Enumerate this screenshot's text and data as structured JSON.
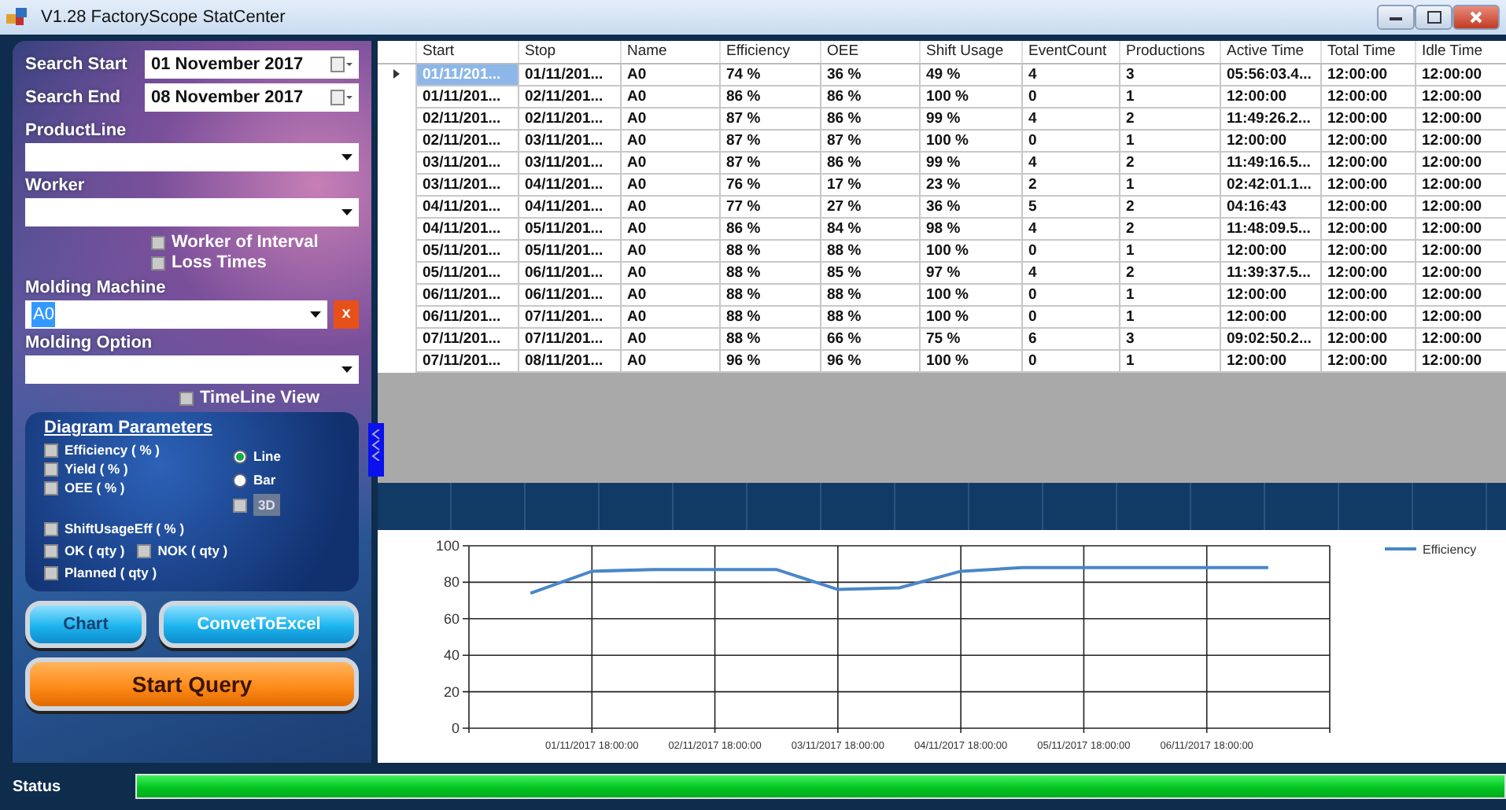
{
  "window": {
    "title": "V1.28 FactoryScope StatCenter"
  },
  "filters": {
    "search_start": {
      "label": "Search Start",
      "value": "01 November 2017"
    },
    "search_end": {
      "label": "Search End",
      "value": "08 November 2017"
    },
    "product_line": {
      "label": "ProductLine"
    },
    "worker": {
      "label": "Worker"
    },
    "worker_options": [
      {
        "label": "Worker of Interval",
        "checked": false
      },
      {
        "label": "Loss Times",
        "checked": false
      }
    ],
    "molding_machine": {
      "label": "Molding Machine",
      "value": "A0",
      "clear": "x"
    },
    "molding_option": {
      "label": "Molding Option"
    },
    "timeline_view": {
      "label": "TimeLine View",
      "checked": false
    }
  },
  "diagram_parameters": {
    "title": "Diagram Parameters",
    "column_a": [
      {
        "kind": "checkbox",
        "label": "Efficiency ( % )",
        "checked": false
      },
      {
        "kind": "checkbox",
        "label": "Yield ( % )",
        "checked": false
      },
      {
        "kind": "checkbox",
        "label": "OEE ( % )",
        "checked": false
      }
    ],
    "column_b": [
      {
        "kind": "radio",
        "label": "Line",
        "selected": true,
        "disabled": false
      },
      {
        "kind": "radio",
        "label": "Bar",
        "selected": false,
        "disabled": false
      },
      {
        "kind": "checkbox",
        "label": "3D",
        "checked": false,
        "disabled": true
      }
    ],
    "rows": [
      [
        {
          "label": "ShiftUsageEff ( % )",
          "checked": false
        }
      ],
      [
        {
          "label": "OK ( qty )",
          "checked": false
        },
        {
          "label": "NOK ( qty )",
          "checked": false
        }
      ],
      [
        {
          "label": "Planned ( qty )",
          "checked": false
        }
      ]
    ]
  },
  "buttons": {
    "chart": "Chart",
    "excel": "ConvetToExcel",
    "query": "Start Query"
  },
  "table": {
    "columns": [
      "Start",
      "Stop",
      "Name",
      "Efficiency",
      "OEE",
      "Shift Usage",
      "EventCount",
      "Productions",
      "Active Time",
      "Total Time",
      "Idle Time"
    ],
    "rows": [
      {
        "selected": true,
        "cells": [
          "01/11/201...",
          "01/11/201...",
          "A0",
          "74 %",
          "36 %",
          "49 %",
          "4",
          "3",
          "05:56:03.4...",
          "12:00:00",
          "12:00:00"
        ]
      },
      {
        "selected": false,
        "cells": [
          "01/11/201...",
          "02/11/201...",
          "A0",
          "86 %",
          "86 %",
          "100 %",
          "0",
          "1",
          "12:00:00",
          "12:00:00",
          "12:00:00"
        ]
      },
      {
        "selected": false,
        "cells": [
          "02/11/201...",
          "02/11/201...",
          "A0",
          "87 %",
          "86 %",
          "99 %",
          "4",
          "2",
          "11:49:26.2...",
          "12:00:00",
          "12:00:00"
        ]
      },
      {
        "selected": false,
        "cells": [
          "02/11/201...",
          "03/11/201...",
          "A0",
          "87 %",
          "87 %",
          "100 %",
          "0",
          "1",
          "12:00:00",
          "12:00:00",
          "12:00:00"
        ]
      },
      {
        "selected": false,
        "cells": [
          "03/11/201...",
          "03/11/201...",
          "A0",
          "87 %",
          "86 %",
          "99 %",
          "4",
          "2",
          "11:49:16.5...",
          "12:00:00",
          "12:00:00"
        ]
      },
      {
        "selected": false,
        "cells": [
          "03/11/201...",
          "04/11/201...",
          "A0",
          "76 %",
          "17 %",
          "23 %",
          "2",
          "1",
          "02:42:01.1...",
          "12:00:00",
          "12:00:00"
        ]
      },
      {
        "selected": false,
        "cells": [
          "04/11/201...",
          "04/11/201...",
          "A0",
          "77 %",
          "27 %",
          "36 %",
          "5",
          "2",
          "04:16:43",
          "12:00:00",
          "12:00:00"
        ]
      },
      {
        "selected": false,
        "cells": [
          "04/11/201...",
          "05/11/201...",
          "A0",
          "86 %",
          "84 %",
          "98 %",
          "4",
          "2",
          "11:48:09.5...",
          "12:00:00",
          "12:00:00"
        ]
      },
      {
        "selected": false,
        "cells": [
          "05/11/201...",
          "05/11/201...",
          "A0",
          "88 %",
          "88 %",
          "100 %",
          "0",
          "1",
          "12:00:00",
          "12:00:00",
          "12:00:00"
        ]
      },
      {
        "selected": false,
        "cells": [
          "05/11/201...",
          "06/11/201...",
          "A0",
          "88 %",
          "85 %",
          "97 %",
          "4",
          "2",
          "11:39:37.5...",
          "12:00:00",
          "12:00:00"
        ]
      },
      {
        "selected": false,
        "cells": [
          "06/11/201...",
          "06/11/201...",
          "A0",
          "88 %",
          "88 %",
          "100 %",
          "0",
          "1",
          "12:00:00",
          "12:00:00",
          "12:00:00"
        ]
      },
      {
        "selected": false,
        "cells": [
          "06/11/201...",
          "07/11/201...",
          "A0",
          "88 %",
          "88 %",
          "100 %",
          "0",
          "1",
          "12:00:00",
          "12:00:00",
          "12:00:00"
        ]
      },
      {
        "selected": false,
        "cells": [
          "07/11/201...",
          "07/11/201...",
          "A0",
          "88 %",
          "66 %",
          "75 %",
          "6",
          "3",
          "09:02:50.2...",
          "12:00:00",
          "12:00:00"
        ]
      },
      {
        "selected": false,
        "cells": [
          "07/11/201...",
          "08/11/201...",
          "A0",
          "96 %",
          "96 %",
          "100 %",
          "0",
          "1",
          "12:00:00",
          "12:00:00",
          "12:00:00"
        ]
      }
    ]
  },
  "chart": {
    "chart_data": {
      "type": "line",
      "categories": [
        null,
        "01/11/2017 18:00:00",
        null,
        "02/11/2017 18:00:00",
        null,
        "03/11/2017 18:00:00",
        null,
        "04/11/2017 18:00:00",
        null,
        "05/11/2017 18:00:00",
        null,
        "06/11/2017 18:00:00",
        null
      ],
      "series": [
        {
          "name": "Efficiency",
          "color": "#4a86c8",
          "values": [
            74,
            86,
            87,
            87,
            87,
            76,
            77,
            86,
            88,
            88,
            88,
            88,
            88
          ]
        }
      ],
      "ylim": [
        0,
        100
      ],
      "grid": true,
      "yticks": [
        0,
        20,
        40,
        60,
        80,
        100
      ]
    }
  },
  "status_bar": {
    "label": "Status",
    "level": 1
  }
}
